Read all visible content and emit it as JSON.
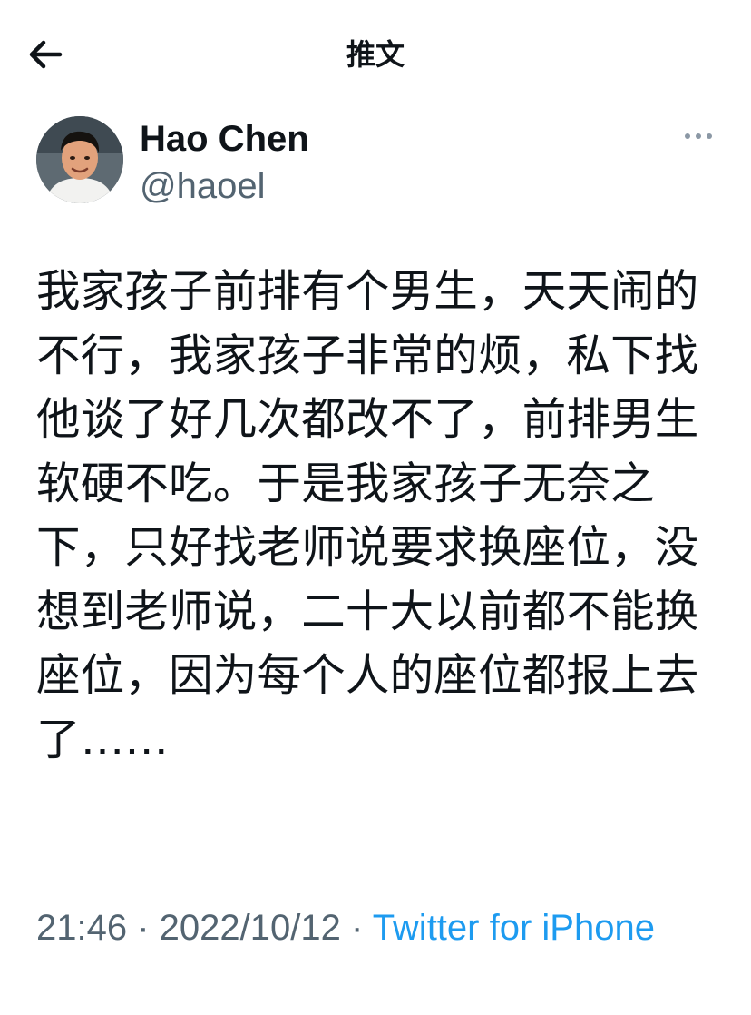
{
  "header": {
    "title": "推文",
    "back_icon": "arrow-left-icon"
  },
  "tweet": {
    "author": {
      "display_name": "Hao Chen",
      "handle": "@haoel",
      "avatar_icon": "avatar"
    },
    "more_icon": "more-horizontal-icon",
    "text": "我家孩子前排有个男生，天天闹的不行，我家孩子非常的烦，私下找他谈了好几次都改不了，前排男生软硬不吃。于是我家孩子无奈之下，只好找老师说要求换座位，没想到老师说，二十大以前都不能换座位，因为每个人的座位都报上去了……",
    "time": "21:46",
    "separator": " · ",
    "date": "2022/10/12",
    "source": "Twitter for iPhone"
  },
  "colors": {
    "text": "#0f1419",
    "secondary": "#536471",
    "link": "#1d9bf0"
  }
}
